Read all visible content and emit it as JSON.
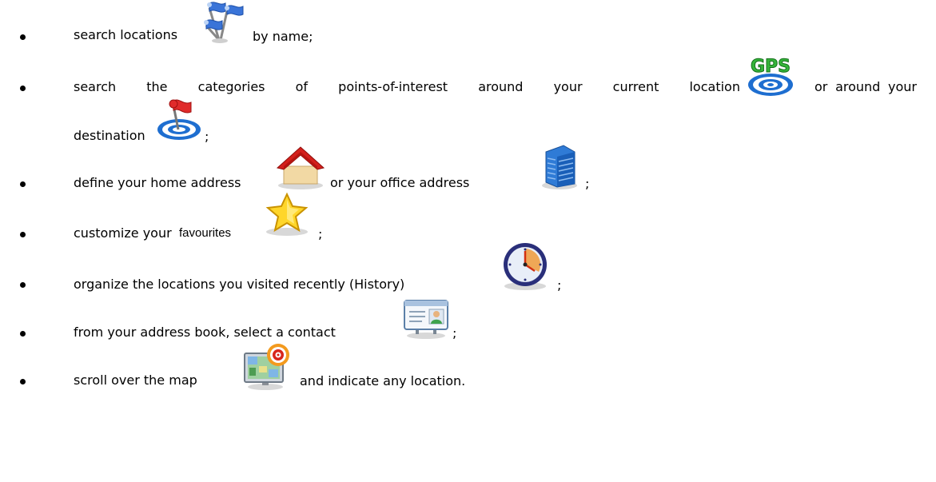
{
  "items": [
    {
      "parts": [
        "search locations",
        "by name;"
      ],
      "icon": "flags-icon"
    },
    {
      "words": [
        "search",
        "the",
        "categories",
        "of",
        "points-of-interest",
        "around",
        "your",
        "current",
        "location"
      ],
      "tail_words": [
        "or",
        "around",
        "your"
      ],
      "line2": [
        "destination",
        ";"
      ],
      "icons": [
        "gps-target-icon",
        "destination-flag-target-icon"
      ]
    },
    {
      "parts": [
        "define your home address",
        "or your office address",
        ";"
      ],
      "icons": [
        "home-icon",
        "office-building-icon"
      ]
    },
    {
      "parts": [
        "customize your",
        "favourites",
        ";"
      ],
      "icon": "star-icon"
    },
    {
      "parts": [
        "organize the locations you visited recently (History)",
        ";"
      ],
      "icon": "clock-icon"
    },
    {
      "parts": [
        "from your address book, select a contact",
        ";"
      ],
      "icon": "contact-card-icon"
    },
    {
      "parts": [
        "scroll over the map",
        "and indicate any location."
      ],
      "icon": "map-target-icon"
    }
  ],
  "colors": {
    "bullet": "#000000",
    "text": "#000000"
  }
}
